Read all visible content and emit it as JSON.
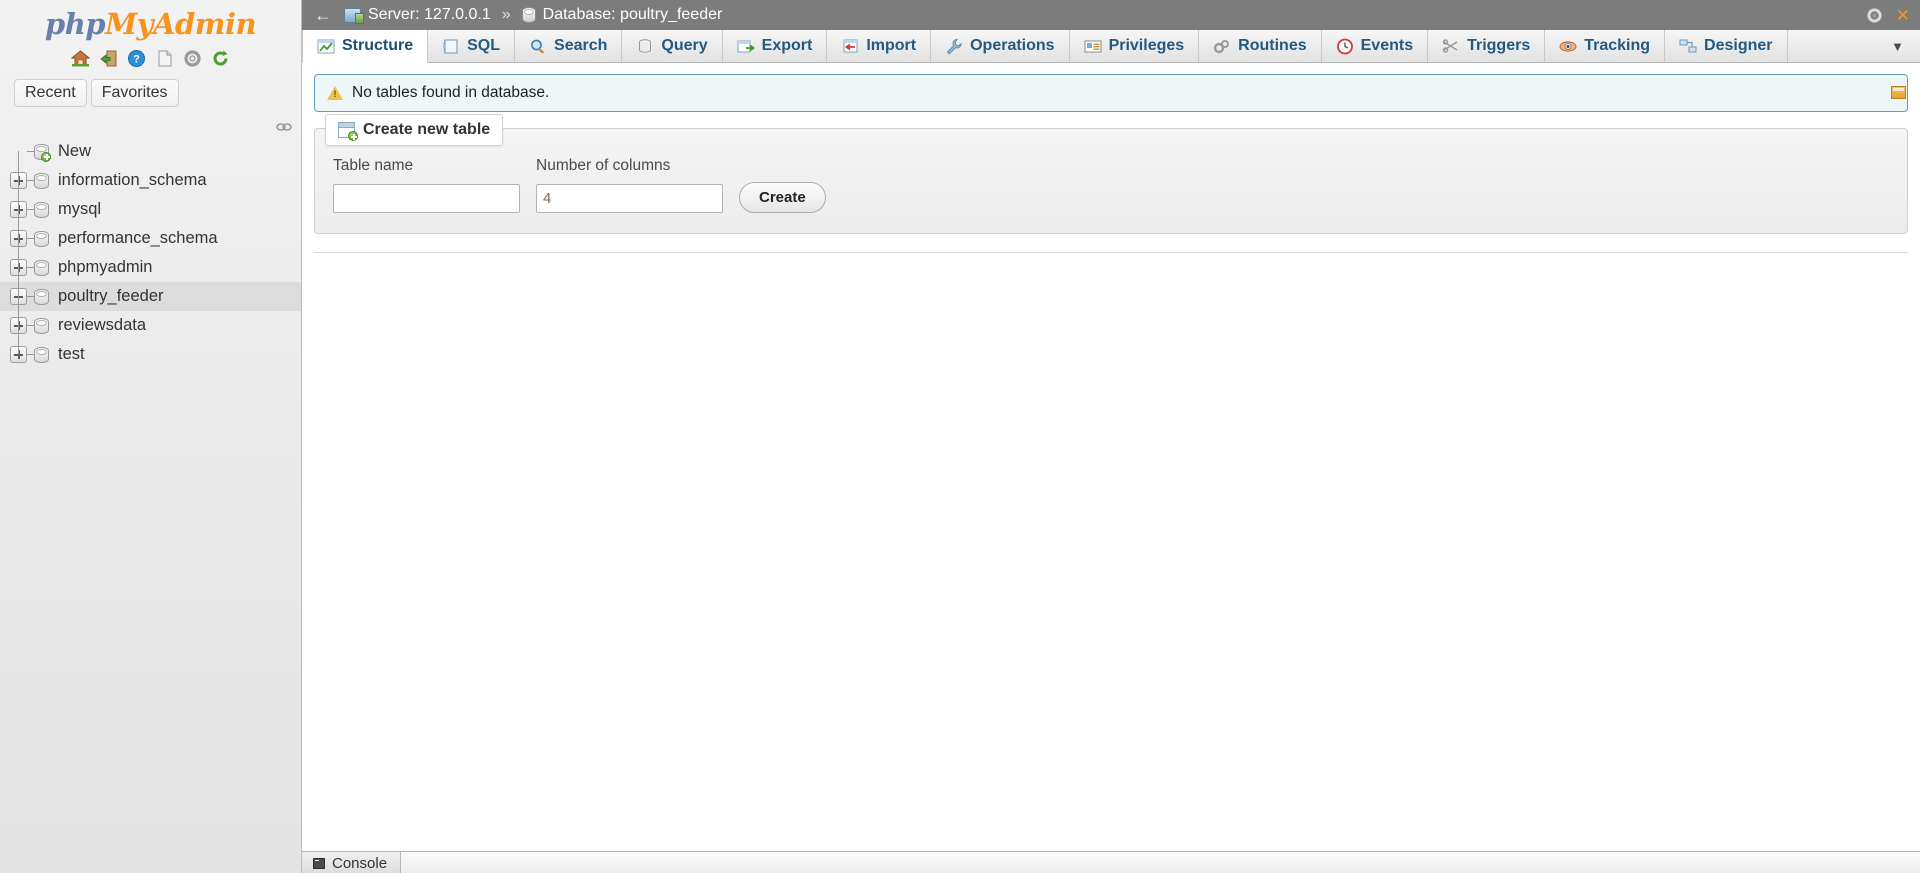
{
  "sidebar": {
    "logo": {
      "part1": "php",
      "part2": "MyAdmin"
    },
    "logo_icons": [
      {
        "name": "home-icon",
        "title": "Home"
      },
      {
        "name": "logout-icon",
        "title": "Log out"
      },
      {
        "name": "help-icon",
        "title": "phpMyAdmin documentation"
      },
      {
        "name": "docs-icon",
        "title": "Documentation"
      },
      {
        "name": "settings-icon",
        "title": "Settings"
      },
      {
        "name": "reload-icon",
        "title": "Reload navigation"
      }
    ],
    "tabs": [
      {
        "label": "Recent",
        "name": "recent"
      },
      {
        "label": "Favorites",
        "name": "favorites"
      }
    ],
    "tree": [
      {
        "label": "New",
        "ctl": "none",
        "icon": "new-db-icon",
        "selected": false
      },
      {
        "label": "information_schema",
        "ctl": "plus",
        "icon": "db-icon",
        "selected": false
      },
      {
        "label": "mysql",
        "ctl": "plus",
        "icon": "db-icon",
        "selected": false
      },
      {
        "label": "performance_schema",
        "ctl": "plus",
        "icon": "db-icon",
        "selected": false
      },
      {
        "label": "phpmyadmin",
        "ctl": "plus",
        "icon": "db-icon",
        "selected": false
      },
      {
        "label": "poultry_feeder",
        "ctl": "minus",
        "icon": "db-icon",
        "selected": true
      },
      {
        "label": "reviewsdata",
        "ctl": "plus",
        "icon": "db-icon",
        "selected": false
      },
      {
        "label": "test",
        "ctl": "plus",
        "icon": "db-icon",
        "selected": false
      }
    ]
  },
  "topbar": {
    "back_arrow": "←",
    "server_label": "Server: 127.0.0.1",
    "separator": "»",
    "database_label": "Database: poultry_feeder",
    "close_glyph": "✕"
  },
  "nav_tabs": [
    {
      "label": "Structure",
      "icon": "structure-icon",
      "active": true
    },
    {
      "label": "SQL",
      "icon": "sql-icon",
      "active": false
    },
    {
      "label": "Search",
      "icon": "search-icon",
      "active": false
    },
    {
      "label": "Query",
      "icon": "query-icon",
      "active": false
    },
    {
      "label": "Export",
      "icon": "export-icon",
      "active": false
    },
    {
      "label": "Import",
      "icon": "import-icon",
      "active": false
    },
    {
      "label": "Operations",
      "icon": "wrench-icon",
      "active": false
    },
    {
      "label": "Privileges",
      "icon": "privileges-icon",
      "active": false
    },
    {
      "label": "Routines",
      "icon": "routines-icon",
      "active": false
    },
    {
      "label": "Events",
      "icon": "clock-icon",
      "active": false
    },
    {
      "label": "Triggers",
      "icon": "triggers-icon",
      "active": false
    },
    {
      "label": "Tracking",
      "icon": "eye-icon",
      "active": false
    },
    {
      "label": "Designer",
      "icon": "designer-icon",
      "active": false
    }
  ],
  "tabs_more_glyph": "▼",
  "notice": {
    "text": "No tables found in database."
  },
  "create_table": {
    "legend": "Create new table",
    "table_name_label": "Table name",
    "table_name_value": "",
    "table_name_placeholder": "",
    "num_columns_label": "Number of columns",
    "num_columns_value": "4",
    "create_button": "Create"
  },
  "console": {
    "label": "Console"
  },
  "colors": {
    "brand_blue": "#6a80ac",
    "brand_orange": "#f7941e",
    "tab_text": "#235a81",
    "notice_border": "#5f9cb4",
    "notice_bg": "#eef6f8",
    "topbar_bg": "#7c7c7c",
    "selected_row": "#dcdcdc"
  }
}
